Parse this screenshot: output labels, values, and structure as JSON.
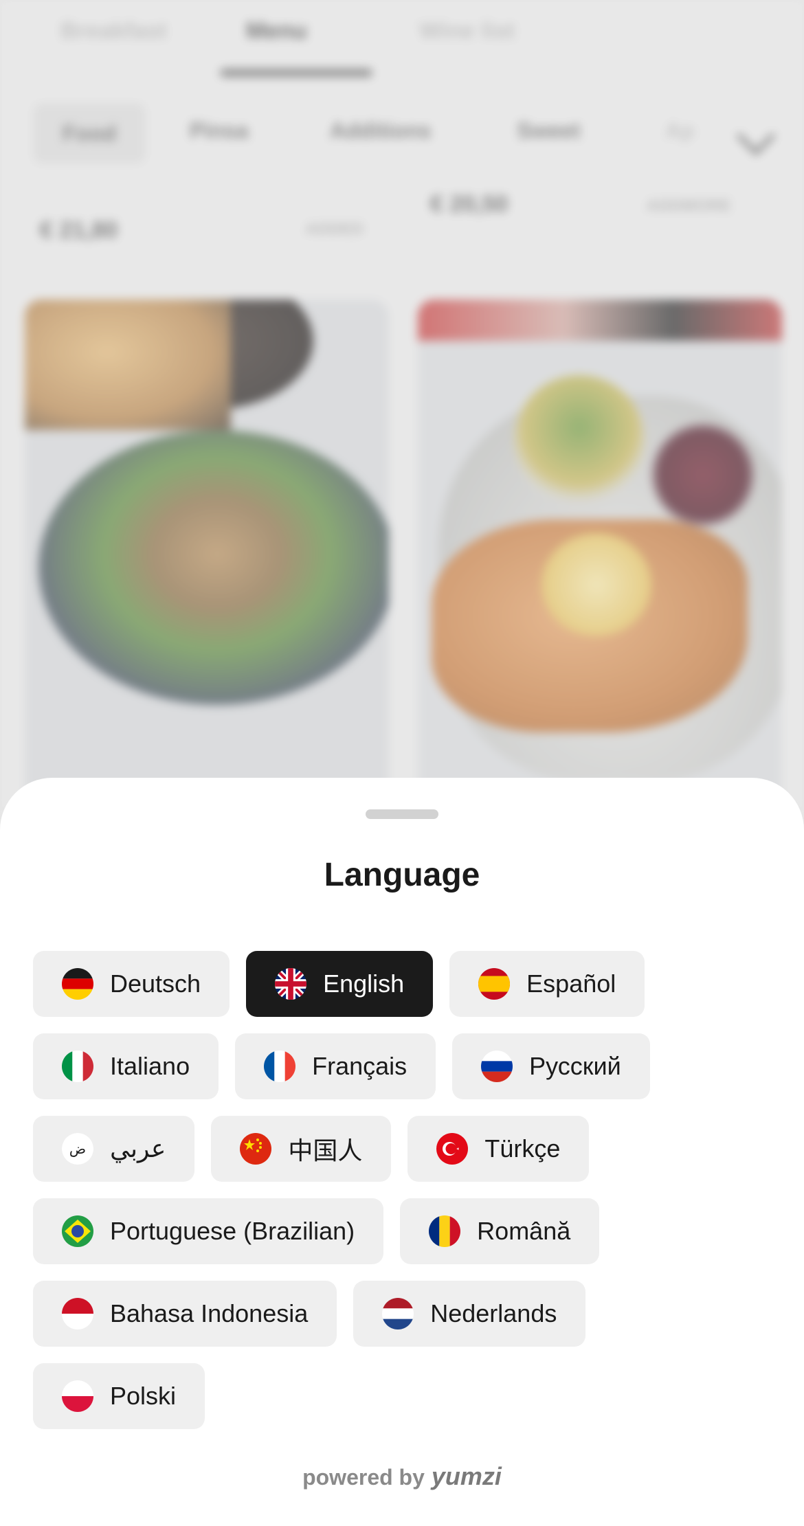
{
  "background": {
    "tabs": [
      "Breakfast",
      "Menu",
      "Wine list"
    ],
    "categories": [
      "Food",
      "Pinsa",
      "Additions",
      "Sweet",
      "Ap"
    ],
    "prices": [
      "€ 21,80",
      "€ 20,50"
    ],
    "price_tags": [
      "ADDED",
      "ADDMORE"
    ]
  },
  "sheet": {
    "title": "Language",
    "powered_by": "powered by",
    "brand": "yumzi"
  },
  "languages": [
    {
      "label": "Deutsch",
      "flag": "de-flag-icon"
    },
    {
      "label": "English",
      "flag": "gb-flag-icon",
      "selected": true
    },
    {
      "label": "Español",
      "flag": "es-flag-icon"
    },
    {
      "label": "Italiano",
      "flag": "it-flag-icon"
    },
    {
      "label": "Français",
      "flag": "fr-flag-icon"
    },
    {
      "label": "Русский",
      "flag": "ru-flag-icon"
    },
    {
      "label": "عربي",
      "flag": "ar-icon",
      "icon_text": "ض"
    },
    {
      "label": "中国人",
      "flag": "cn-flag-icon"
    },
    {
      "label": "Türkçe",
      "flag": "tr-flag-icon"
    },
    {
      "label": "Portuguese (Brazilian)",
      "flag": "br-flag-icon"
    },
    {
      "label": "Română",
      "flag": "ro-flag-icon"
    },
    {
      "label": "Bahasa Indonesia",
      "flag": "id-flag-icon"
    },
    {
      "label": "Nederlands",
      "flag": "nl-flag-icon"
    },
    {
      "label": "Polski",
      "flag": "pl-flag-icon"
    }
  ],
  "colors": {
    "selected_chip": "#1b1b1b",
    "chip": "#efefef"
  }
}
